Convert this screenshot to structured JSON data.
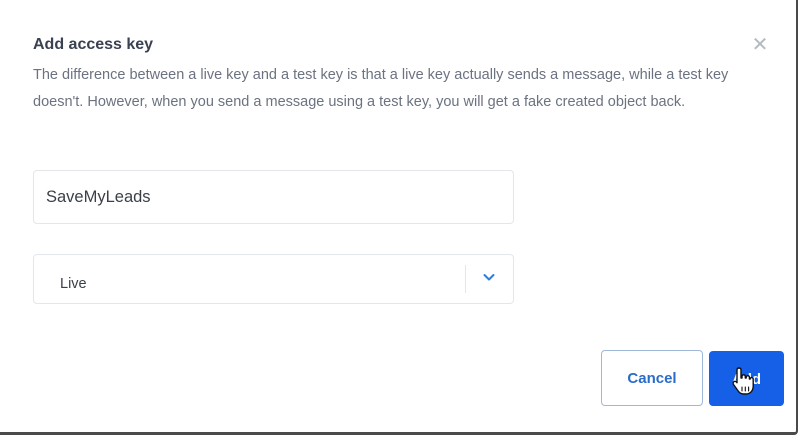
{
  "dialog": {
    "title": "Add access key",
    "close_icon": "close-icon",
    "description": "The difference between a live key and a test key is that a live key actually sends a message, while a test key doesn't. However, when you send a message using a test key, you will get a fake created object back."
  },
  "form": {
    "name_value": "SaveMyLeads",
    "key_type": {
      "selected": "Live",
      "icon": "chevron-down-icon"
    }
  },
  "actions": {
    "cancel_label": "Cancel",
    "add_label": "Add"
  },
  "colors": {
    "primary": "#1560e6",
    "primary_text": "#2a6cc7",
    "title": "#3a4150",
    "muted_text": "#6b7280",
    "border": "#e3e6ea"
  },
  "pointer": "hand-pointer-icon"
}
